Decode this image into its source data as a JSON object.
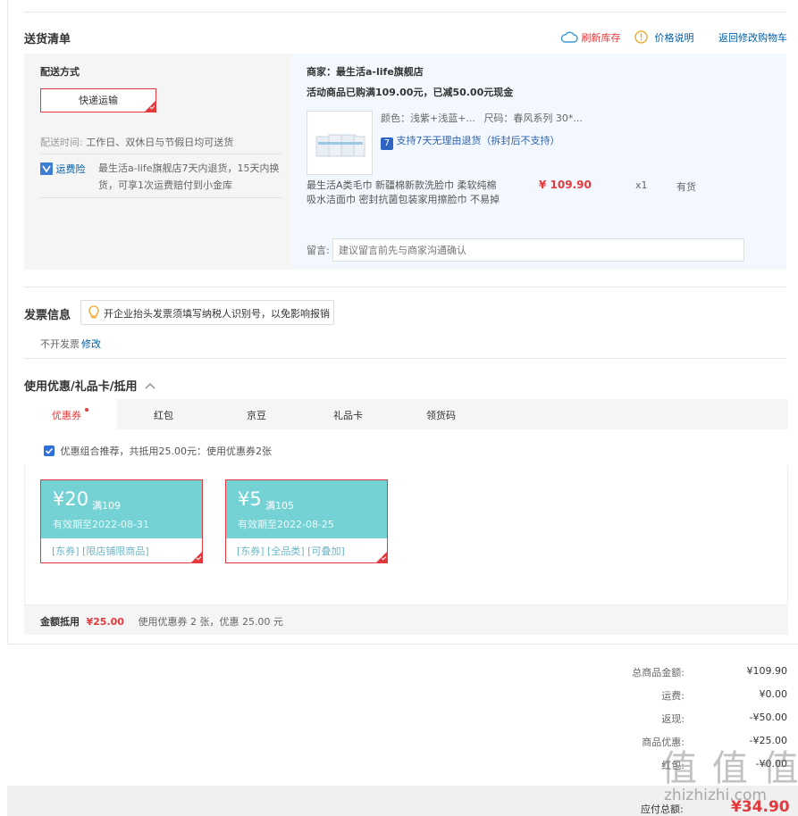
{
  "header": {
    "title": "送货清单",
    "refresh_stock": "刷新库存",
    "price_note": "价格说明",
    "back_to_cart": "返回修改购物车"
  },
  "delivery": {
    "method_label": "配送方式",
    "method_button": "快递运输",
    "time_label": "配送时间:",
    "time_value": "工作日、双休日与节假日均可送货",
    "insurance_label": "运费险",
    "insurance_text_1": "最生活a-life旗舰店7天内退货，15天内换",
    "insurance_text_2": "货，可享1次运费赔付到小金库"
  },
  "shop": {
    "seller": "商家：最生活a-life旗舰店",
    "promo": "活动商品已购满109.00元，已减50.00元现金",
    "color": "颜色：浅紫+浅蓝+...",
    "size": "尺码：春风系列 30*...",
    "return_policy": "支持7天无理由退货（拆封后不支持）",
    "return_badge": "7",
    "product_name_1": "最生活A类毛巾 新疆棉新款洗脸巾 柔软纯棉",
    "product_name_2": "吸水洁面巾 密封抗菌包装家用擦脸巾 不易掉",
    "price": "¥ 109.90",
    "qty": "x1",
    "stock": "有货",
    "remark_label": "留言:",
    "remark_placeholder": "建议留言前先与商家沟通确认"
  },
  "invoice": {
    "title": "发票信息",
    "tip": "开企业抬头发票须填写纳税人识别号，以免影响报销",
    "status": "不开发票",
    "edit": "修改"
  },
  "discounts": {
    "title": "使用优惠/礼品卡/抵用",
    "tabs": [
      "优惠券",
      "红包",
      "京豆",
      "礼品卡",
      "领货码"
    ],
    "recommend": "优惠组合推荐，共抵用25.00元：使用优惠券2张",
    "coupons": [
      {
        "amount": "¥20",
        "threshold": "满109",
        "expire": "有效期至2022-08-31",
        "tags": "[东券]  [限店铺限商品]"
      },
      {
        "amount": "¥5",
        "threshold": "满105",
        "expire": "有效期至2022-08-25",
        "tags": "[东券]  [全品类]  [可叠加]"
      }
    ],
    "deduct_label": "金额抵用",
    "deduct_value": "¥25.00",
    "deduct_desc": "使用优惠券 2 张，优惠 25.00 元"
  },
  "summary": {
    "rows": [
      {
        "label": "总商品金额:",
        "value": "¥109.90"
      },
      {
        "label": "运费:",
        "value": "¥0.00"
      },
      {
        "label": "返现:",
        "value": "-¥50.00"
      },
      {
        "label": "商品优惠:",
        "value": "-¥25.00"
      },
      {
        "label": "红包:",
        "value": "-¥0.00"
      }
    ],
    "payable_label": "应付总额:",
    "payable_value": "¥34.90"
  },
  "watermark": {
    "text": "值 值 值",
    "site": "zhizhizhi.com"
  },
  "colors": {
    "accent": "#e4393c",
    "link": "#005ea7",
    "coupon": "#74d2d4"
  }
}
